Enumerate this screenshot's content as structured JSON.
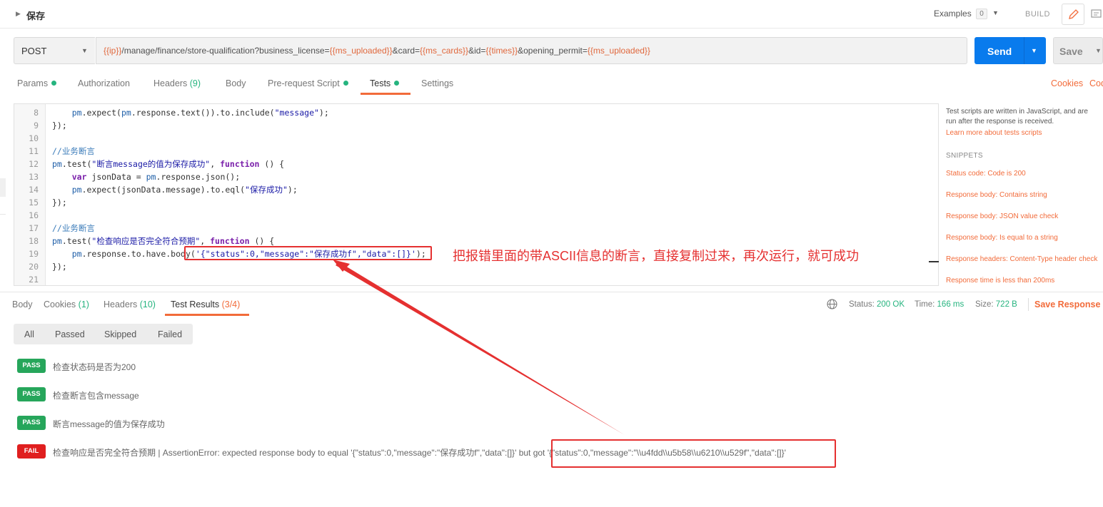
{
  "title_bar": {
    "title": "保存",
    "examples_label": "Examples",
    "examples_count": "0",
    "build_label": "BUILD"
  },
  "url_bar": {
    "method": "POST",
    "url_parts": [
      {
        "text": "{{ip}}",
        "var": true
      },
      {
        "text": "/manage/finance/store-qualification?business_license=",
        "var": false
      },
      {
        "text": "{{ms_uploaded}}",
        "var": true
      },
      {
        "text": "&card=",
        "var": false
      },
      {
        "text": "{{ms_cards}}",
        "var": true
      },
      {
        "text": "&id=",
        "var": false
      },
      {
        "text": "{{times}}",
        "var": true
      },
      {
        "text": "&opening_permit=",
        "var": false
      },
      {
        "text": "{{ms_uploaded}}",
        "var": true
      }
    ],
    "send_label": "Send",
    "save_label": "Save"
  },
  "request_tabs": {
    "params": "Params",
    "authorization": "Authorization",
    "headers": "Headers",
    "headers_count": "(9)",
    "body": "Body",
    "prerequest": "Pre-request Script",
    "tests": "Tests",
    "settings": "Settings",
    "cookies": "Cookies",
    "code": "Code"
  },
  "editor": {
    "lines": [
      {
        "n": "8",
        "html": "    <span class=\"pm\">pm</span>.expect(<span class=\"pm\">pm</span>.response.text()).to.include(<span class=\"str\">\"message\"</span>);"
      },
      {
        "n": "9",
        "html": "});"
      },
      {
        "n": "10",
        "html": ""
      },
      {
        "n": "11",
        "html": "<span class=\"cmt\">//业务断言</span>"
      },
      {
        "n": "12",
        "html": "<span class=\"pm\">pm</span>.test(<span class=\"str\">\"断言message的值为保存成功\"</span>, <span class=\"kw\">function</span> () {"
      },
      {
        "n": "13",
        "html": "    <span class=\"kw\">var</span> jsonData = <span class=\"pm\">pm</span>.response.json();"
      },
      {
        "n": "14",
        "html": "    <span class=\"pm\">pm</span>.expect(jsonData.message).to.eql(<span class=\"str\">\"保存成功\"</span>);"
      },
      {
        "n": "15",
        "html": "});"
      },
      {
        "n": "16",
        "html": ""
      },
      {
        "n": "17",
        "html": "<span class=\"cmt\">//业务断言</span>"
      },
      {
        "n": "18",
        "html": "<span class=\"pm\">pm</span>.test(<span class=\"str\">\"检查响应是否完全符合预期\"</span>, <span class=\"kw\">function</span> () {"
      },
      {
        "n": "19",
        "html": "    <span class=\"pm\">pm</span>.response.to.have.body(<span class=\"str\">'{\"status\":0,\"message\":\"保存成功f\",\"data\":[]}'</span>);"
      },
      {
        "n": "20",
        "html": "});"
      },
      {
        "n": "21",
        "html": ""
      }
    ]
  },
  "sidebar": {
    "description": "Test scripts are written in JavaScript, and are run after the response is received.",
    "learn_more": "Learn more about tests scripts",
    "snippets_title": "SNIPPETS",
    "snippets": [
      "Status code: Code is 200",
      "Response body: Contains string",
      "Response body: JSON value check",
      "Response body: Is equal to a string",
      "Response headers: Content-Type header check",
      "Response time is less than 200ms"
    ]
  },
  "response_tabs": {
    "body": "Body",
    "cookies": "Cookies",
    "cookies_count": "(1)",
    "headers": "Headers",
    "headers_count": "(10)",
    "test_results": "Test Results",
    "test_results_count": "(3/4)"
  },
  "response_stats": {
    "status_label": "Status:",
    "status_value": "200 OK",
    "time_label": "Time:",
    "time_value": "166 ms",
    "size_label": "Size:",
    "size_value": "722 B",
    "save_response": "Save Response"
  },
  "filters": [
    "All",
    "Passed",
    "Skipped",
    "Failed"
  ],
  "results": [
    {
      "status": "PASS",
      "text": "检查状态码是否为200"
    },
    {
      "status": "PASS",
      "text": "检查断言包含message"
    },
    {
      "status": "PASS",
      "text": "断言message的值为保存成功"
    },
    {
      "status": "FAIL",
      "text": "检查响应是否完全符合预期 | AssertionError: expected response body to equal '{\"status\":0,\"message\":\"保存成功f\",\"data\":[]}' but got '{\"status\":0,\"message\":\"\\\\u4fdd\\\\u5b58\\\\u6210\\\\u529f\",\"data\":[]}'"
    }
  ],
  "annotation": {
    "text": "把报错里面的带ASCII信息的断言，直接复制过来，再次运行，就可成功"
  },
  "colors": {
    "accent": "#f26b3a",
    "send_blue": "#097bed",
    "pass_green": "#26a65b",
    "fail_red": "#e01f1f",
    "annotation_red": "#e53030"
  }
}
